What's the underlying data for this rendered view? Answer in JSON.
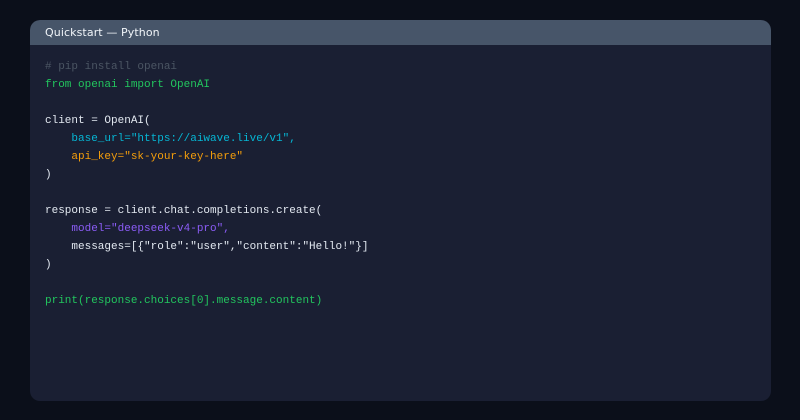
{
  "panel": {
    "title": "Quickstart — Python"
  },
  "code": {
    "lines": [
      {
        "text": "# pip install openai",
        "kind": "comment"
      },
      {
        "text": "from openai import OpenAI",
        "kind": "green"
      },
      {
        "text": "",
        "kind": "plain"
      },
      {
        "text": "client = OpenAI(",
        "kind": "plain"
      },
      {
        "text": "    base_url=\"https://aiwave.live/v1\",",
        "kind": "cyan"
      },
      {
        "text": "    api_key=\"sk-your-key-here\"",
        "kind": "orange"
      },
      {
        "text": ")",
        "kind": "plain"
      },
      {
        "text": "",
        "kind": "plain"
      },
      {
        "text": "response = client.chat.completions.create(",
        "kind": "plain"
      },
      {
        "text": "    model=\"deepseek-v4-pro\",",
        "kind": "purple"
      },
      {
        "text": "    messages=[{\"role\":\"user\",\"content\":\"Hello!\"}]",
        "kind": "plain"
      },
      {
        "text": ")",
        "kind": "plain"
      },
      {
        "text": "",
        "kind": "plain"
      },
      {
        "text": "print(response.choices[0].message.content)",
        "kind": "green"
      }
    ]
  },
  "colors": {
    "background": "#0b0f1a",
    "panel": "#1a1f33",
    "header": "#475569",
    "comment": "#4b5563",
    "green": "#22c55e",
    "cyan": "#06b6d4",
    "orange": "#f59e0b",
    "purple": "#8b5cf6"
  }
}
